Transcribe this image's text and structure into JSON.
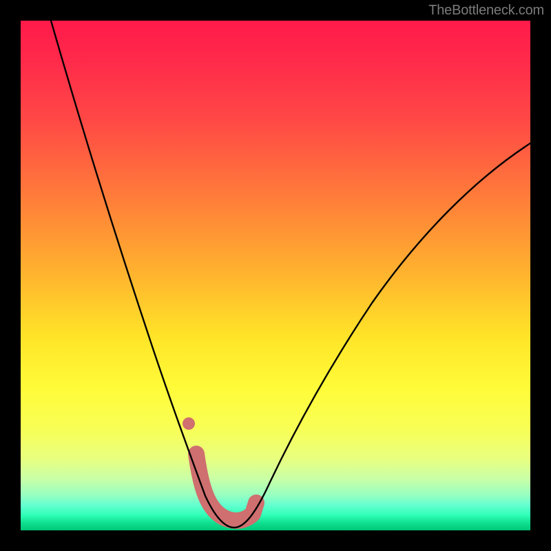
{
  "watermark": {
    "text": "TheBottleneck.com"
  },
  "chart_data": {
    "type": "line",
    "title": "",
    "xlabel": "",
    "ylabel": "",
    "xlim": [
      0,
      100
    ],
    "ylim": [
      0,
      100
    ],
    "grid": false,
    "legend": false,
    "background_gradient": {
      "orientation": "vertical",
      "stops": [
        {
          "pos": 0.0,
          "color": "#ff1a4a"
        },
        {
          "pos": 0.2,
          "color": "#ff4a45"
        },
        {
          "pos": 0.48,
          "color": "#ffad2f"
        },
        {
          "pos": 0.72,
          "color": "#fffb38"
        },
        {
          "pos": 0.9,
          "color": "#c8ffa8"
        },
        {
          "pos": 1.0,
          "color": "#00c878"
        }
      ]
    },
    "series": [
      {
        "name": "bottleneck-curve",
        "stroke": "#000000",
        "stroke_width": 2,
        "x": [
          6,
          10,
          14,
          18,
          22,
          26,
          30,
          32,
          34,
          36,
          38,
          40,
          42,
          44,
          46,
          50,
          54,
          58,
          62,
          66,
          70,
          76,
          82,
          88,
          94,
          100
        ],
        "y": [
          100,
          89,
          78,
          67,
          57,
          47,
          35,
          28,
          20,
          12,
          6,
          3,
          2,
          2,
          4,
          10,
          18,
          26,
          33,
          40,
          46,
          54,
          61,
          67,
          72,
          76
        ]
      },
      {
        "name": "highlight-band",
        "stroke": "#cf6f6f",
        "stroke_width": 16,
        "linecap": "round",
        "x": [
          34.5,
          36,
          38,
          40,
          42,
          44,
          45.5
        ],
        "y": [
          15,
          8,
          4,
          2,
          2,
          4,
          8
        ]
      },
      {
        "name": "highlight-dot",
        "type": "scatter",
        "stroke": "#cf6f6f",
        "marker_radius": 7,
        "x": [
          33
        ],
        "y": [
          21
        ]
      }
    ]
  }
}
